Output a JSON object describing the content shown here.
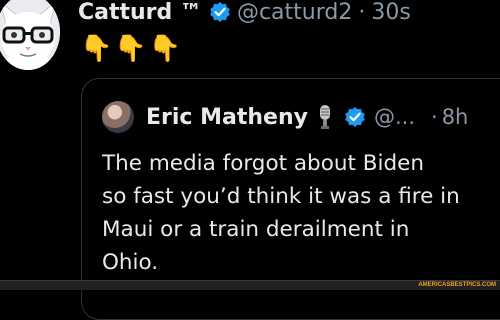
{
  "tweet": {
    "display_name": "Catturd ™",
    "handle": "@catturd2",
    "separator": "·",
    "time": "30s",
    "text": "👇👇👇"
  },
  "quote": {
    "display_name": "Eric Matheny",
    "handle": "@...",
    "separator": "·",
    "time": "8h",
    "text": "The media forgot about Biden\nso fast you’d think it was a fire in\nMaui or a train derailment in\nOhio."
  },
  "footer": {
    "watermark": "AMERICASBESTPICS.COM"
  },
  "colors": {
    "background": "#000000",
    "text": "#e7e9ea",
    "muted": "#8b98a5",
    "verified": "#1d9bf0",
    "border": "#2f3336"
  },
  "icons": {
    "verified": "verified-badge-icon",
    "mic": "microphone-icon"
  }
}
